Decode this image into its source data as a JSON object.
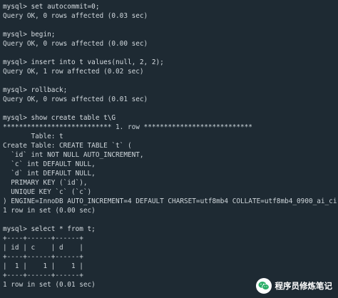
{
  "terminal": {
    "lines": [
      "mysql> set autocommit=0;",
      "Query OK, 0 rows affected (0.03 sec)",
      "",
      "mysql> begin;",
      "Query OK, 0 rows affected (0.00 sec)",
      "",
      "mysql> insert into t values(null, 2, 2);",
      "Query OK, 1 row affected (0.02 sec)",
      "",
      "mysql> rollback;",
      "Query OK, 0 rows affected (0.01 sec)",
      "",
      "mysql> show create table t\\G",
      "*************************** 1. row ***************************",
      "       Table: t",
      "Create Table: CREATE TABLE `t` (",
      "  `id` int NOT NULL AUTO_INCREMENT,",
      "  `c` int DEFAULT NULL,",
      "  `d` int DEFAULT NULL,",
      "  PRIMARY KEY (`id`),",
      "  UNIQUE KEY `c` (`c`)",
      ") ENGINE=InnoDB AUTO_INCREMENT=4 DEFAULT CHARSET=utf8mb4 COLLATE=utf8mb4_0900_ai_ci",
      "1 row in set (0.00 sec)",
      "",
      "mysql> select * from t;",
      "+----+------+------+",
      "| id | c    | d    |",
      "+----+------+------+",
      "|  1 |    1 |    1 |",
      "+----+------+------+",
      "1 row in set (0.01 sec)"
    ]
  },
  "watermark": {
    "text": "程序员修炼笔记",
    "icon": "wechat-icon"
  },
  "colors": {
    "background": "#1e2a33",
    "text": "#d7dde2"
  }
}
